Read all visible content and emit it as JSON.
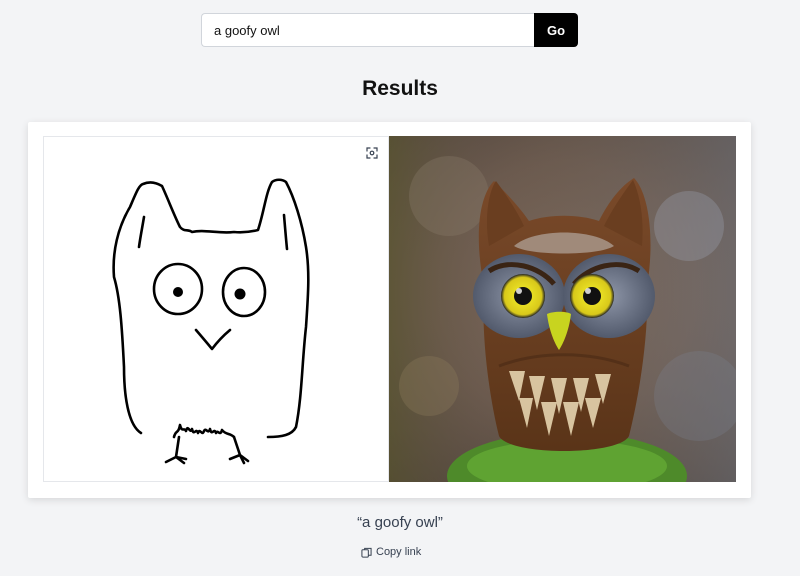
{
  "search": {
    "value": "a goofy owl",
    "go_label": "Go"
  },
  "results": {
    "heading": "Results",
    "caption": "“a goofy owl”",
    "copy_link_label": "Copy link"
  },
  "icons": {
    "fit": "fit-to-screen-icon",
    "copy": "copy-icon"
  },
  "colors": {
    "background": "#f3f4f6",
    "go_button": "#000000",
    "card": "#ffffff"
  }
}
